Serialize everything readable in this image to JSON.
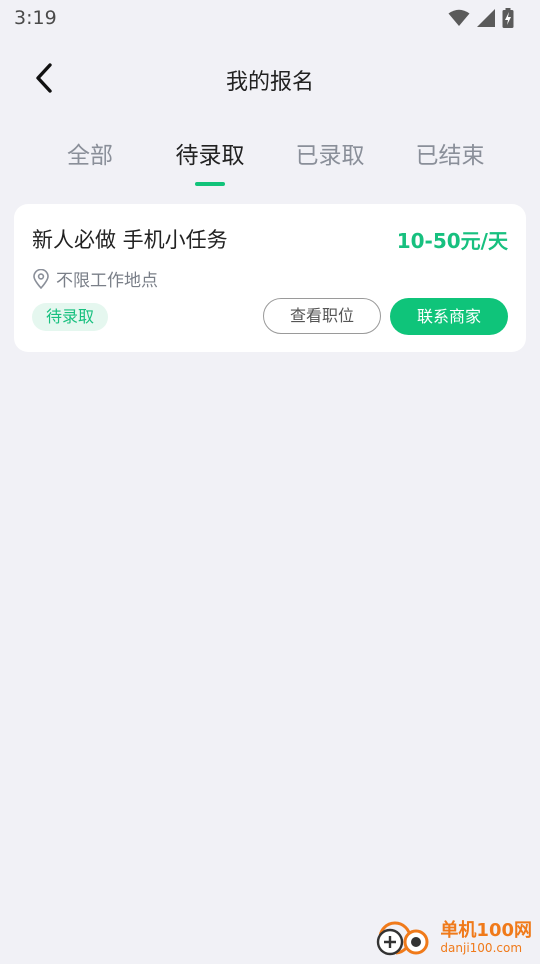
{
  "status_bar": {
    "time": "3:19",
    "icons": [
      "wifi-icon",
      "cellular-icon",
      "battery-charging-icon"
    ]
  },
  "header": {
    "title": "我的报名",
    "back_icon": "chevron-left-icon"
  },
  "tabs": [
    {
      "label": "全部",
      "active": false
    },
    {
      "label": "待录取",
      "active": true
    },
    {
      "label": "已录取",
      "active": false
    },
    {
      "label": "已结束",
      "active": false
    }
  ],
  "job_card": {
    "title": "新人必做 手机小任务",
    "salary": "10-50元/天",
    "location": "不限工作地点",
    "status": "待录取",
    "view_button": "查看职位",
    "contact_button": "联系商家"
  },
  "watermark": {
    "name": "单机100网",
    "domain": "danji100.com"
  },
  "colors": {
    "accent": "#0fc47a",
    "background": "#f1f1f6",
    "watermark": "#f07a1a"
  }
}
